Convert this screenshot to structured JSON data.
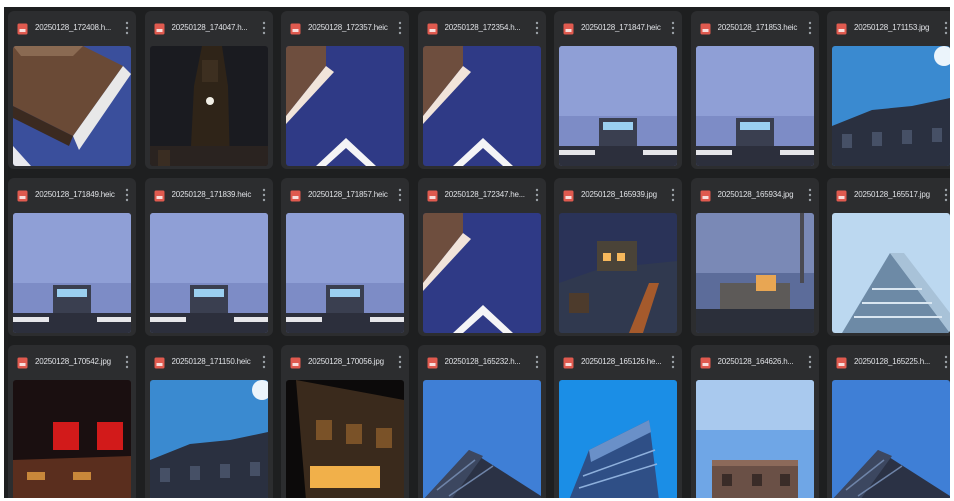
{
  "file_icon": "image-file-icon",
  "more_icon": "more-vertical-icon",
  "colors": {
    "background": "#1e1f20",
    "card": "#2c2d2f",
    "file_icon": "#e05a4f",
    "title": "#dfe1e5"
  },
  "files": [
    {
      "name": "20250128_172408.h...",
      "scene": "corner-brick-low"
    },
    {
      "name": "20250128_174047.h...",
      "scene": "church-night"
    },
    {
      "name": "20250128_172357.heic",
      "scene": "corner-peak"
    },
    {
      "name": "20250128_172354.h...",
      "scene": "corner-peak"
    },
    {
      "name": "20250128_171847.heic",
      "scene": "tower-dusk"
    },
    {
      "name": "20250128_171853.heic",
      "scene": "tower-dusk"
    },
    {
      "name": "20250128_171153.jpg",
      "scene": "sun-facade"
    },
    {
      "name": "20250128_171849.heic",
      "scene": "tower-dusk"
    },
    {
      "name": "20250128_171839.heic",
      "scene": "tower-dusk"
    },
    {
      "name": "20250128_171857.heic",
      "scene": "tower-dusk"
    },
    {
      "name": "20250128_172347.he...",
      "scene": "corner-peak"
    },
    {
      "name": "20250128_165939.jpg",
      "scene": "city-night"
    },
    {
      "name": "20250128_165934.jpg",
      "scene": "city-dusk"
    },
    {
      "name": "20250128_165517.jpg",
      "scene": "tall-glass"
    },
    {
      "name": "20250128_170542.jpg",
      "scene": "red-room"
    },
    {
      "name": "20250128_171150.heic",
      "scene": "sun-facade"
    },
    {
      "name": "20250128_170056.jpg",
      "scene": "night-facade"
    },
    {
      "name": "20250128_165232.h...",
      "scene": "modern-blue"
    },
    {
      "name": "20250128_165126.he...",
      "scene": "office-blue"
    },
    {
      "name": "20250128_164626.h...",
      "scene": "house-sky"
    },
    {
      "name": "20250128_165225.h...",
      "scene": "modern-blue"
    }
  ]
}
